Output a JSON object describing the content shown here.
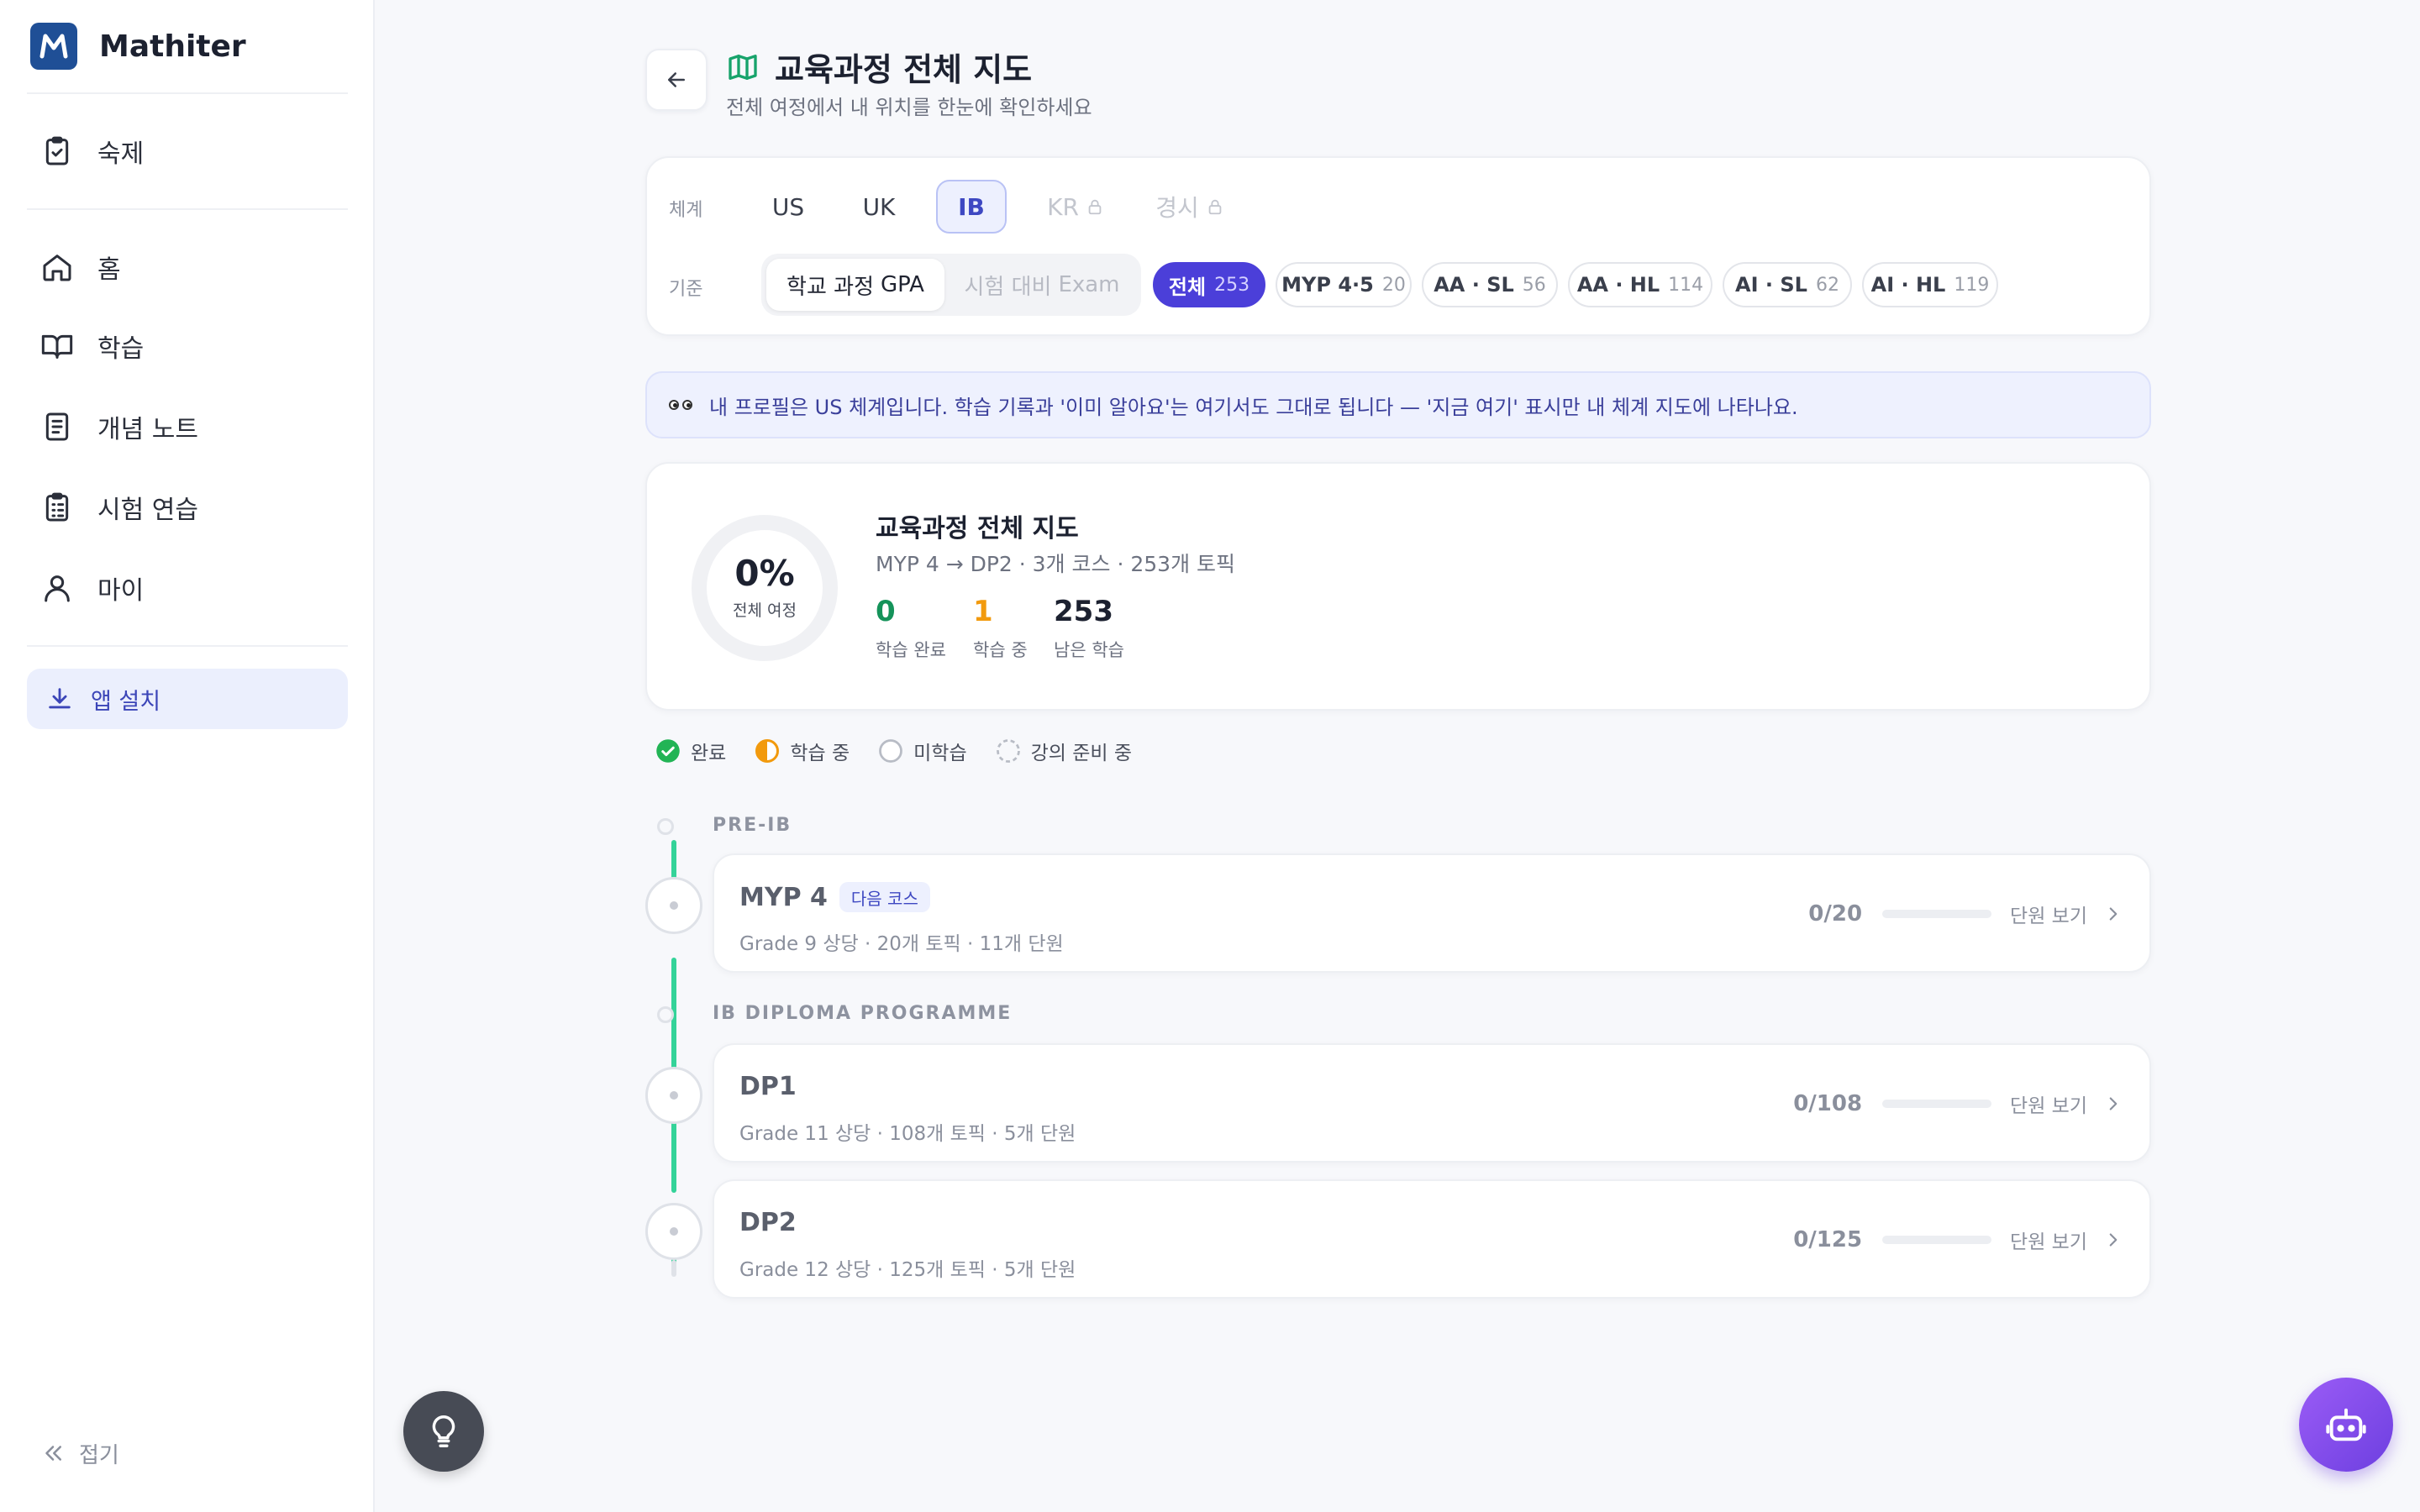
{
  "sidebar": {
    "brand": "Mathiter",
    "items": [
      {
        "label": "숙제",
        "icon": "clipboard-check-icon"
      },
      {
        "label": "홈",
        "icon": "home-icon"
      },
      {
        "label": "학습",
        "icon": "book-open-icon"
      },
      {
        "label": "개념 노트",
        "icon": "notebook-icon"
      },
      {
        "label": "시험 연습",
        "icon": "clipboard-list-icon"
      },
      {
        "label": "마이",
        "icon": "user-icon"
      }
    ],
    "install_label": "앱 설치",
    "collapse_label": "접기"
  },
  "header": {
    "title": "교육과정 전체 지도",
    "subtitle": "전체 여정에서 내 위치를 한눈에 확인하세요"
  },
  "filters": {
    "system_label": "체계",
    "systems": [
      "US",
      "UK",
      "IB",
      "KR",
      "경시"
    ],
    "active_system": "IB",
    "locked_systems": [
      "KR",
      "경시"
    ],
    "basis_label": "기준",
    "basis_options": [
      {
        "main": "학교 과정",
        "sub": "GPA"
      },
      {
        "main": "시험 대비",
        "sub": "Exam"
      }
    ],
    "chips": [
      {
        "label": "전체",
        "count": "253"
      },
      {
        "label": "MYP 4·5",
        "count": "20"
      },
      {
        "label": "AA · SL",
        "count": "56"
      },
      {
        "label": "AA · HL",
        "count": "114"
      },
      {
        "label": "AI · SL",
        "count": "62"
      },
      {
        "label": "AI · HL",
        "count": "119"
      }
    ]
  },
  "notice": {
    "text": "내 프로필은 US 체계입니다. 학습 기록과 '이미 알아요'는 여기서도 그대로 됩니다 — '지금 여기' 표시만 내 체계 지도에 나타나요."
  },
  "summary": {
    "percent": "0%",
    "percent_value": 0,
    "ring_label": "전체 여정",
    "title": "교육과정 전체 지도",
    "subtitle": "MYP 4 → DP2 · 3개 코스 · 253개 토픽",
    "stats": [
      {
        "value": "0",
        "label": "학습 완료",
        "color": "#15935a"
      },
      {
        "value": "1",
        "label": "학습 중",
        "color": "#f29a0d"
      },
      {
        "value": "253",
        "label": "남은 학습",
        "color": "#1c2130"
      }
    ]
  },
  "legend": [
    {
      "label": "완료",
      "icon": "check-circle-icon"
    },
    {
      "label": "학습 중",
      "icon": "half-circle-icon"
    },
    {
      "label": "미학습",
      "icon": "empty-circle-icon"
    },
    {
      "label": "강의 준비 중",
      "icon": "dashed-circle-icon"
    }
  ],
  "groups": [
    {
      "label": "PRE-IB"
    },
    {
      "label": "IB DIPLOMA PROGRAMME"
    }
  ],
  "courses": [
    {
      "name": "MYP 4",
      "badge": "다음 코스",
      "sub": "Grade 9 상당 · 20개 토픽 · 11개 단원",
      "progress": "0/20",
      "progress_value": 0,
      "link": "단원 보기"
    },
    {
      "name": "DP1",
      "badge": "",
      "sub": "Grade 11 상당 · 108개 토픽 · 5개 단원",
      "progress": "0/108",
      "progress_value": 0,
      "link": "단원 보기"
    },
    {
      "name": "DP2",
      "badge": "",
      "sub": "Grade 12 상당 · 125개 토픽 · 5개 단원",
      "progress": "0/125",
      "progress_value": 0,
      "link": "단원 보기"
    }
  ],
  "colors": {
    "accent": "#4b3fd9",
    "brand": "#1f4f96",
    "timeline": "#34d399"
  }
}
